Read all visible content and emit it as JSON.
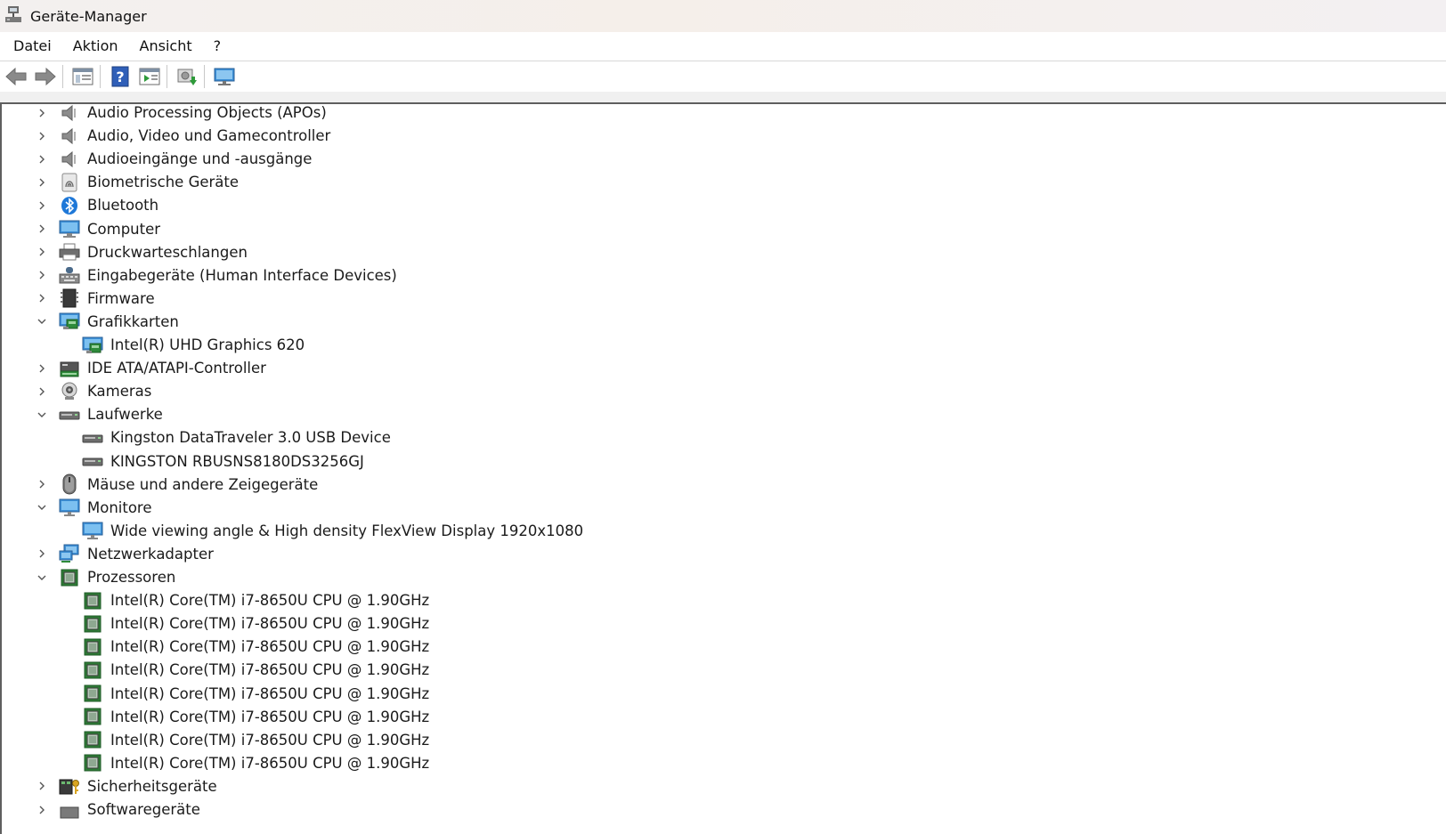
{
  "window": {
    "title": "Geräte-Manager"
  },
  "menu": [
    "Datei",
    "Aktion",
    "Ansicht",
    "?"
  ],
  "toolbar": {
    "buttons": [
      "back-arrow-icon",
      "forward-arrow-icon",
      "properties-icon",
      "help-icon",
      "run-view-icon",
      "scan-hardware-icon",
      "monitor-view-icon"
    ]
  },
  "tree": [
    {
      "label": "Audio Processing Objects (APOs)",
      "icon": "speaker-icon",
      "level": 0,
      "expanded": false
    },
    {
      "label": "Audio, Video und Gamecontroller",
      "icon": "speaker-icon",
      "level": 0,
      "expanded": false
    },
    {
      "label": "Audioeingänge und -ausgänge",
      "icon": "speaker-icon",
      "level": 0,
      "expanded": false
    },
    {
      "label": "Biometrische Geräte",
      "icon": "fingerprint-icon",
      "level": 0,
      "expanded": false
    },
    {
      "label": "Bluetooth",
      "icon": "bluetooth-icon",
      "level": 0,
      "expanded": false
    },
    {
      "label": "Computer",
      "icon": "computer-icon",
      "level": 0,
      "expanded": false
    },
    {
      "label": "Druckwarteschlangen",
      "icon": "printer-icon",
      "level": 0,
      "expanded": false
    },
    {
      "label": "Eingabegeräte (Human Interface Devices)",
      "icon": "hid-icon",
      "level": 0,
      "expanded": false
    },
    {
      "label": "Firmware",
      "icon": "firmware-icon",
      "level": 0,
      "expanded": false
    },
    {
      "label": "Grafikkarten",
      "icon": "display-adapter-icon",
      "level": 0,
      "expanded": true
    },
    {
      "label": "Intel(R) UHD Graphics 620",
      "icon": "display-adapter-icon",
      "level": 1
    },
    {
      "label": "IDE ATA/ATAPI-Controller",
      "icon": "ide-controller-icon",
      "level": 0,
      "expanded": false
    },
    {
      "label": "Kameras",
      "icon": "camera-icon",
      "level": 0,
      "expanded": false
    },
    {
      "label": "Laufwerke",
      "icon": "disk-drive-icon",
      "level": 0,
      "expanded": true
    },
    {
      "label": "Kingston DataTraveler 3.0 USB Device",
      "icon": "disk-drive-icon",
      "level": 1
    },
    {
      "label": "KINGSTON RBUSNS8180DS3256GJ",
      "icon": "disk-drive-icon",
      "level": 1
    },
    {
      "label": "Mäuse und andere Zeigegeräte",
      "icon": "mouse-icon",
      "level": 0,
      "expanded": false
    },
    {
      "label": "Monitore",
      "icon": "monitor-icon",
      "level": 0,
      "expanded": true
    },
    {
      "label": "Wide viewing angle & High density FlexView Display 1920x1080",
      "icon": "monitor-icon",
      "level": 1
    },
    {
      "label": "Netzwerkadapter",
      "icon": "network-adapter-icon",
      "level": 0,
      "expanded": false
    },
    {
      "label": "Prozessoren",
      "icon": "processor-icon",
      "level": 0,
      "expanded": true
    },
    {
      "label": "Intel(R) Core(TM) i7-8650U CPU @ 1.90GHz",
      "icon": "processor-icon",
      "level": 1
    },
    {
      "label": "Intel(R) Core(TM) i7-8650U CPU @ 1.90GHz",
      "icon": "processor-icon",
      "level": 1
    },
    {
      "label": "Intel(R) Core(TM) i7-8650U CPU @ 1.90GHz",
      "icon": "processor-icon",
      "level": 1
    },
    {
      "label": "Intel(R) Core(TM) i7-8650U CPU @ 1.90GHz",
      "icon": "processor-icon",
      "level": 1
    },
    {
      "label": "Intel(R) Core(TM) i7-8650U CPU @ 1.90GHz",
      "icon": "processor-icon",
      "level": 1
    },
    {
      "label": "Intel(R) Core(TM) i7-8650U CPU @ 1.90GHz",
      "icon": "processor-icon",
      "level": 1
    },
    {
      "label": "Intel(R) Core(TM) i7-8650U CPU @ 1.90GHz",
      "icon": "processor-icon",
      "level": 1
    },
    {
      "label": "Intel(R) Core(TM) i7-8650U CPU @ 1.90GHz",
      "icon": "processor-icon",
      "level": 1
    },
    {
      "label": "Sicherheitsgeräte",
      "icon": "security-device-icon",
      "level": 0,
      "expanded": false
    },
    {
      "label": "Softwaregeräte",
      "icon": "software-device-icon",
      "level": 0,
      "expanded": false
    }
  ]
}
